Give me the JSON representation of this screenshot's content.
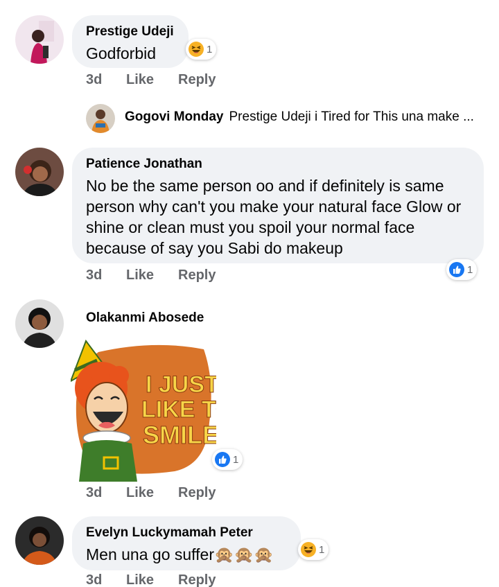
{
  "comments": [
    {
      "author": "Prestige Udeji",
      "text": "Godforbid",
      "time": "3d",
      "like_label": "Like",
      "reply_label": "Reply",
      "reaction": {
        "icon": "haha-emoji-icon",
        "count": "1"
      }
    },
    {
      "author": "Patience Jonathan",
      "text": "No be the same person oo and if definitely is same person why can't you make your natural face Glow or shine or clean must you spoil your normal face because of say you Sabi do makeup",
      "time": "3d",
      "like_label": "Like",
      "reply_label": "Reply",
      "reaction": {
        "icon": "like-thumb-icon",
        "count": "1"
      }
    },
    {
      "author": "Olakanmi Abosede",
      "sticker_text": "I JUST LIKE TO SMILE!",
      "time": "3d",
      "like_label": "Like",
      "reply_label": "Reply",
      "reaction": {
        "icon": "like-thumb-icon",
        "count": "1"
      }
    },
    {
      "author": "Evelyn Luckymamah Peter",
      "text": "Men una go suffer🙊🙊🙊",
      "time": "3d",
      "like_label": "Like",
      "reply_label": "Reply",
      "reaction": {
        "icon": "haha-emoji-icon",
        "count": "1"
      }
    }
  ],
  "reply": {
    "author": "Gogovi Monday",
    "text": "Prestige Udeji i Tired for This una make ..."
  },
  "colors": {
    "bubble": "#f0f2f5",
    "meta": "#65676b",
    "like_blue": "#1877f2",
    "haha_yellow": "#f7b125"
  }
}
